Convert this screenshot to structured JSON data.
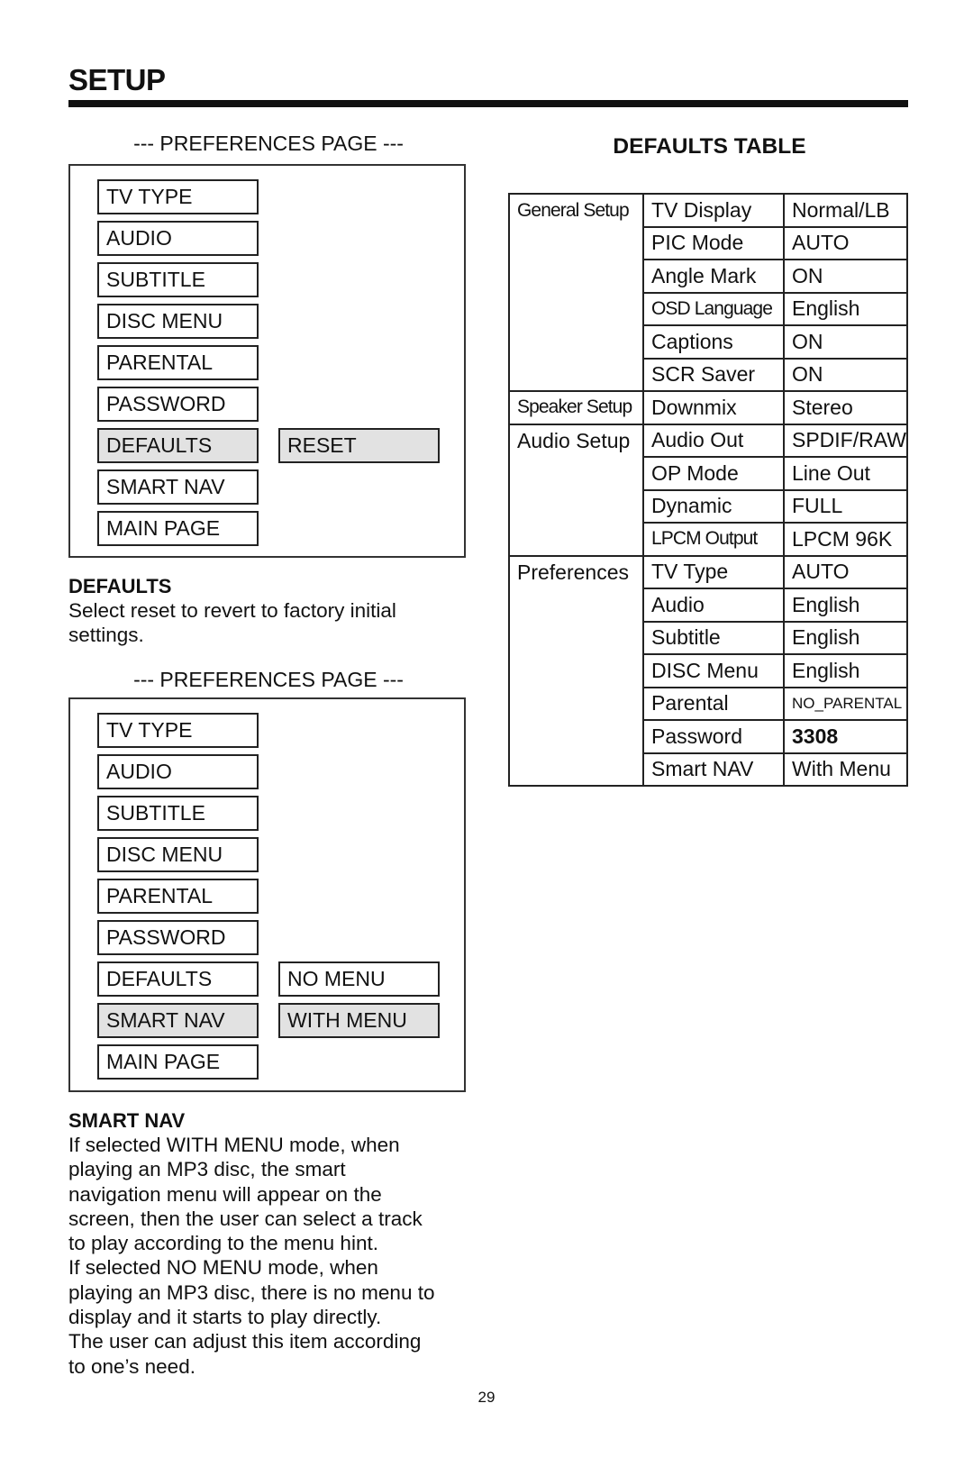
{
  "page": {
    "title": "SETUP",
    "page_number": "29"
  },
  "menu1": {
    "caption": "--- PREFERENCES PAGE ---",
    "items": [
      "TV TYPE",
      "AUDIO",
      "SUBTITLE",
      "DISC MENU",
      "PARENTAL",
      "PASSWORD",
      "DEFAULTS",
      "SMART NAV",
      "MAIN PAGE"
    ],
    "selected_item": "DEFAULTS",
    "options": [
      {
        "label": "RESET",
        "selected": true
      }
    ]
  },
  "defaults_section": {
    "heading": "DEFAULTS",
    "body": "Select reset to revert to factory initial settings."
  },
  "menu2": {
    "caption": "--- PREFERENCES PAGE ---",
    "items": [
      "TV TYPE",
      "AUDIO",
      "SUBTITLE",
      "DISC MENU",
      "PARENTAL",
      "PASSWORD",
      "DEFAULTS",
      "SMART NAV",
      "MAIN PAGE"
    ],
    "selected_item": "SMART NAV",
    "options": [
      {
        "label": "NO MENU",
        "selected": false
      },
      {
        "label": "WITH MENU",
        "selected": true
      }
    ]
  },
  "smart_nav_section": {
    "heading": "SMART NAV",
    "lines": [
      "If selected WITH MENU mode, when",
      "playing an MP3 disc, the smart",
      "navigation menu will appear on the",
      "screen, then the user can select a track",
      "to play according to the menu hint.",
      "If selected NO MENU mode, when",
      "playing an MP3 disc, there is no menu to",
      "display and it starts to play directly.",
      "The user can adjust this item according",
      "to one’s need."
    ]
  },
  "defaults_table": {
    "title": "DEFAULTS TABLE",
    "rows": [
      {
        "group": "General Setup",
        "setting": "TV Display",
        "value": "Normal/LB"
      },
      {
        "group": "",
        "setting": "PIC Mode",
        "value": "AUTO"
      },
      {
        "group": "",
        "setting": "Angle Mark",
        "value": "ON"
      },
      {
        "group": "",
        "setting": "OSD Language",
        "value": "English"
      },
      {
        "group": "",
        "setting": "Captions",
        "value": "ON"
      },
      {
        "group": "",
        "setting": "SCR Saver",
        "value": "ON"
      },
      {
        "group": "Speaker Setup",
        "setting": "Downmix",
        "value": "Stereo"
      },
      {
        "group": "Audio Setup",
        "setting": "Audio Out",
        "value": "SPDIF/RAW"
      },
      {
        "group": "",
        "setting": "OP Mode",
        "value": "Line Out"
      },
      {
        "group": "",
        "setting": "Dynamic",
        "value": "FULL"
      },
      {
        "group": "",
        "setting": "LPCM Output",
        "value": "LPCM 96K"
      },
      {
        "group": "Preferences",
        "setting": "TV Type",
        "value": "AUTO"
      },
      {
        "group": "",
        "setting": "Audio",
        "value": "English"
      },
      {
        "group": "",
        "setting": "Subtitle",
        "value": "English"
      },
      {
        "group": "",
        "setting": "DISC Menu",
        "value": "English"
      },
      {
        "group": "",
        "setting": "Parental",
        "value": "NO_PARENTAL"
      },
      {
        "group": "",
        "setting": "Password",
        "value": "3308"
      },
      {
        "group": "",
        "setting": "Smart NAV",
        "value": "With Menu"
      }
    ]
  }
}
